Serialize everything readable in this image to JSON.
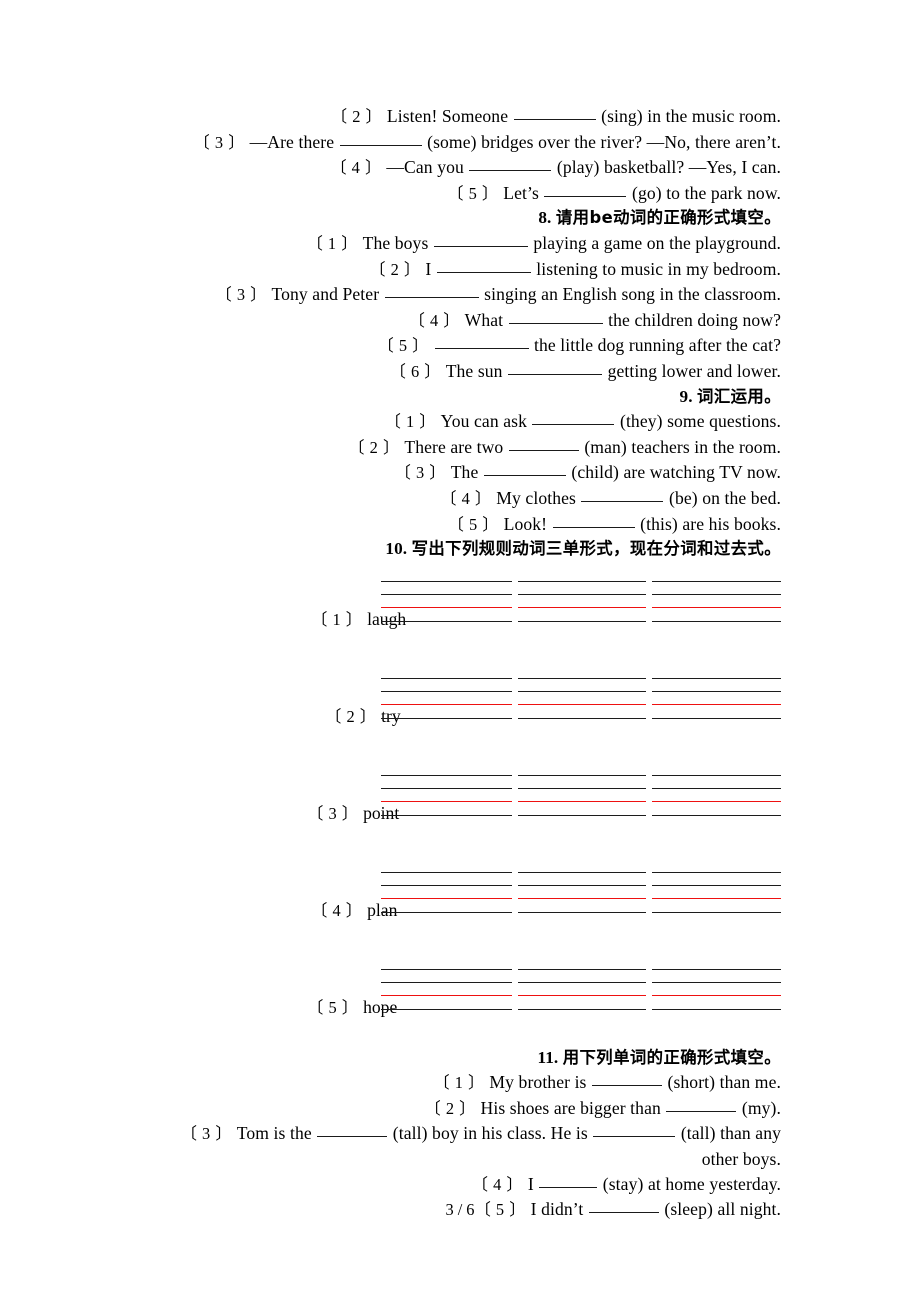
{
  "document": {
    "page_label": "3",
    "page_separator": "/",
    "page_total": "6"
  },
  "exercises": [
    {
      "id": "ex7-continued",
      "items": [
        {
          "number": "〔 2 〕",
          "before": "Listen! Someone",
          "blank": "b-lg",
          "after": "(sing) in the music room."
        },
        {
          "number": "〔 3 〕",
          "before": "—Are there",
          "blank": "b-lg",
          "after": "(some) bridges over the river? —No, there aren’t."
        },
        {
          "number": "〔 4 〕",
          "before": "—Can you",
          "blank": "b-lg",
          "after": "(play) basketball? —Yes, I can."
        },
        {
          "number": "〔 5 〕",
          "before": "Let’s",
          "blank": "b-lg",
          "after": "(go) to the park now."
        }
      ]
    },
    {
      "id": "ex8",
      "heading_number": "8.",
      "heading_cn": "请用be动词的正确形式填空。",
      "items": [
        {
          "number": "〔 1 〕",
          "before": "The boys",
          "blank": "b-xl",
          "after": "playing a game on the playground."
        },
        {
          "number": "〔 2 〕",
          "before": "I",
          "blank": "b-xl",
          "after": "listening to music in my bedroom."
        },
        {
          "number": "〔 3 〕",
          "before": "Tony and Peter",
          "blank": "b-xl",
          "after": "singing an English song in the classroom."
        },
        {
          "number": "〔 4 〕",
          "before": "What",
          "blank": "b-xl",
          "after": "the children doing now?"
        },
        {
          "number": "〔 5 〕",
          "before": "",
          "blank": "b-xl",
          "after": "the little dog running after the cat?"
        },
        {
          "number": "〔 6 〕",
          "before": "The sun",
          "blank": "b-xl",
          "after": "getting lower and lower."
        }
      ]
    },
    {
      "id": "ex9",
      "heading_number": "9.",
      "heading_cn": "词汇运用。",
      "items": [
        {
          "number": "〔 1 〕",
          "before": "You can ask",
          "blank": "b-lg",
          "after": "(they) some questions."
        },
        {
          "number": "〔 2 〕",
          "before": "There are two",
          "blank": "b-md",
          "after": "(man) teachers in the room."
        },
        {
          "number": "〔 3 〕",
          "before": "The",
          "blank": "b-lg",
          "after": "(child) are watching TV now."
        },
        {
          "number": "〔 4 〕",
          "before": "My clothes",
          "blank": "b-lg",
          "after": "(be) on the bed."
        },
        {
          "number": "〔 5 〕",
          "before": "Look!",
          "blank": "b-lg",
          "after": "(this) are his books."
        }
      ]
    },
    {
      "id": "ex10",
      "heading_number": "10.",
      "heading_cn": "写出下列规则动词三单形式，现在分词和过去式。",
      "words": [
        {
          "number": "〔 1 〕",
          "word": "laugh"
        },
        {
          "number": "〔 2 〕",
          "word": "try"
        },
        {
          "number": "〔 3 〕",
          "word": "point"
        },
        {
          "number": "〔 4 〕",
          "word": "plan"
        },
        {
          "number": "〔 5 〕",
          "word": "hope"
        }
      ],
      "guide_columns": 3,
      "guide_line_colors": [
        "#1c1c1c",
        "#1c1c1c",
        "#ee1111",
        "#1c1c1c"
      ]
    },
    {
      "id": "ex11",
      "heading_number": "11.",
      "heading_cn": "用下列单词的正确形式填空。",
      "items": [
        {
          "number": "〔 1 〕",
          "before": "My brother is",
          "blank": "b-md",
          "after": "(short) than me."
        },
        {
          "number": "〔 2 〕",
          "before": "His shoes are bigger than",
          "blank": "b-md",
          "after": "(my)."
        },
        {
          "number": "〔 3 〕",
          "before": "Tom is the",
          "blank": "b-md",
          "after": "(tall) boy in his class. He is",
          "blank2": "b-lg",
          "after2": "(tall) than any",
          "continuation": "other boys."
        },
        {
          "number": "〔 4 〕",
          "before": "I",
          "blank": "b-sm",
          "after": "(stay) at home yesterday."
        },
        {
          "number": "〔 5 〕",
          "before": "I didn’t",
          "blank": "b-md",
          "after": "(sleep) all night."
        }
      ]
    }
  ]
}
